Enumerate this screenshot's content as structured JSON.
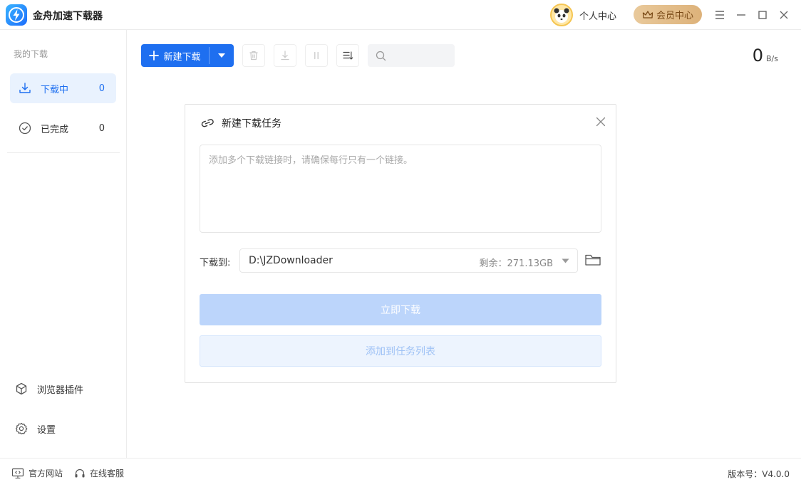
{
  "app": {
    "title": "金舟加速下载器"
  },
  "header": {
    "profile_label": "个人中心",
    "vip_label": "会员中心"
  },
  "sidebar": {
    "heading": "我的下载",
    "items": [
      {
        "label": "下载中",
        "count": "0",
        "active": true
      },
      {
        "label": "已完成",
        "count": "0",
        "active": false
      }
    ],
    "bottom": [
      {
        "label": "浏览器插件"
      },
      {
        "label": "设置"
      }
    ]
  },
  "toolbar": {
    "new_download_label": "新建下载",
    "search_placeholder": ""
  },
  "speed": {
    "value": "0",
    "unit": "B/s"
  },
  "dialog": {
    "title": "新建下载任务",
    "links_placeholder": "添加多个下载链接时，请确保每行只有一个链接。",
    "save_to_label": "下载到:",
    "path": "D:\\JZDownloader",
    "free_space": "剩余：271.13GB",
    "download_now_label": "立即下载",
    "add_to_list_label": "添加到任务列表"
  },
  "statusbar": {
    "website_label": "官方网站",
    "support_label": "在线客服",
    "version": "版本号：V4.0.0"
  },
  "colors": {
    "primary": "#1e6ff0",
    "primary_disabled": "#bcd5fb",
    "vip_gold": "#ddb27a"
  }
}
